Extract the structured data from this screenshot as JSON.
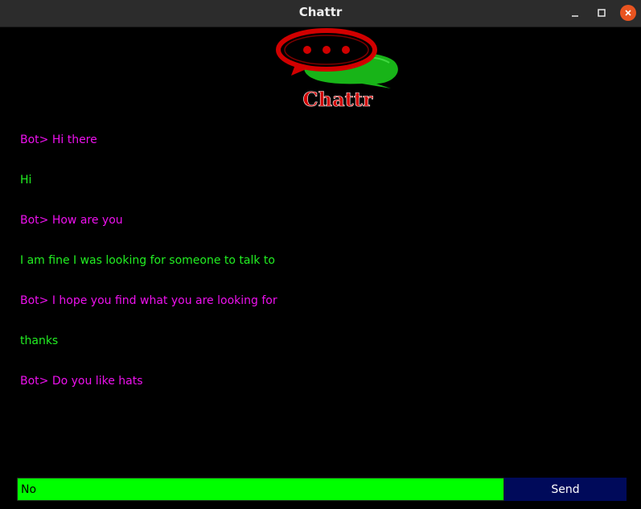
{
  "window": {
    "title": "Chattr"
  },
  "logo": {
    "wordmark": "Chattr",
    "colors": {
      "red": "#d10000",
      "green": "#18b418"
    }
  },
  "messages": [
    {
      "sender": "bot",
      "text": "Bot> Hi there"
    },
    {
      "sender": "user",
      "text": "Hi"
    },
    {
      "sender": "bot",
      "text": "Bot> How are you"
    },
    {
      "sender": "user",
      "text": "I am fine I was looking for someone to talk to"
    },
    {
      "sender": "bot",
      "text": "Bot> I hope you find what you are looking for"
    },
    {
      "sender": "user",
      "text": "thanks"
    },
    {
      "sender": "bot",
      "text": "Bot> Do you like hats"
    }
  ],
  "composer": {
    "input_value": "No",
    "send_label": "Send"
  },
  "colors": {
    "bot_text": "#ee11ee",
    "user_text": "#22ee22",
    "input_bg": "#00ff00",
    "send_bg": "#000a5a",
    "close_button": "#e95420"
  }
}
